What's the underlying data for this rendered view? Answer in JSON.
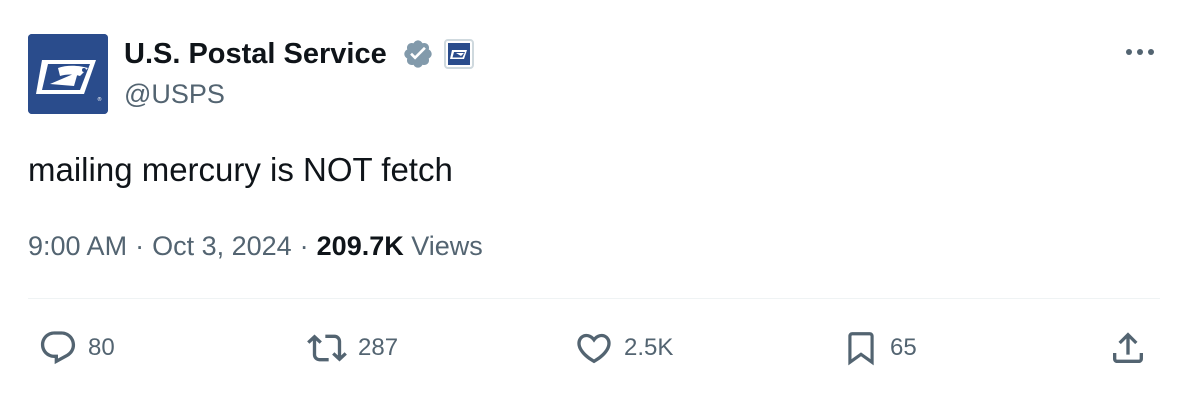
{
  "author": {
    "display_name": "U.S. Postal Service",
    "handle": "@USPS",
    "avatar_icon": "usps-eagle-logo",
    "verified_icon": "verified-badge-icon",
    "affiliate_icon": "usps-affiliate-badge",
    "brand_color": "#2a4c8c",
    "verified_color": "#829aab"
  },
  "more_icon": "ellipsis-icon",
  "tweet": {
    "text": "mailing mercury is NOT fetch",
    "time": "9:00 AM",
    "date": "Oct 3, 2024",
    "separator": "·",
    "views_count": "209.7K",
    "views_label": "Views"
  },
  "actions": {
    "reply": {
      "icon": "reply-icon",
      "count": "80"
    },
    "retweet": {
      "icon": "retweet-icon",
      "count": "287"
    },
    "like": {
      "icon": "heart-icon",
      "count": "2.5K"
    },
    "bookmark": {
      "icon": "bookmark-icon",
      "count": "65"
    },
    "share": {
      "icon": "share-icon"
    }
  },
  "colors": {
    "text_primary": "#0f1419",
    "text_secondary": "#536471",
    "divider": "#eff3f4"
  }
}
